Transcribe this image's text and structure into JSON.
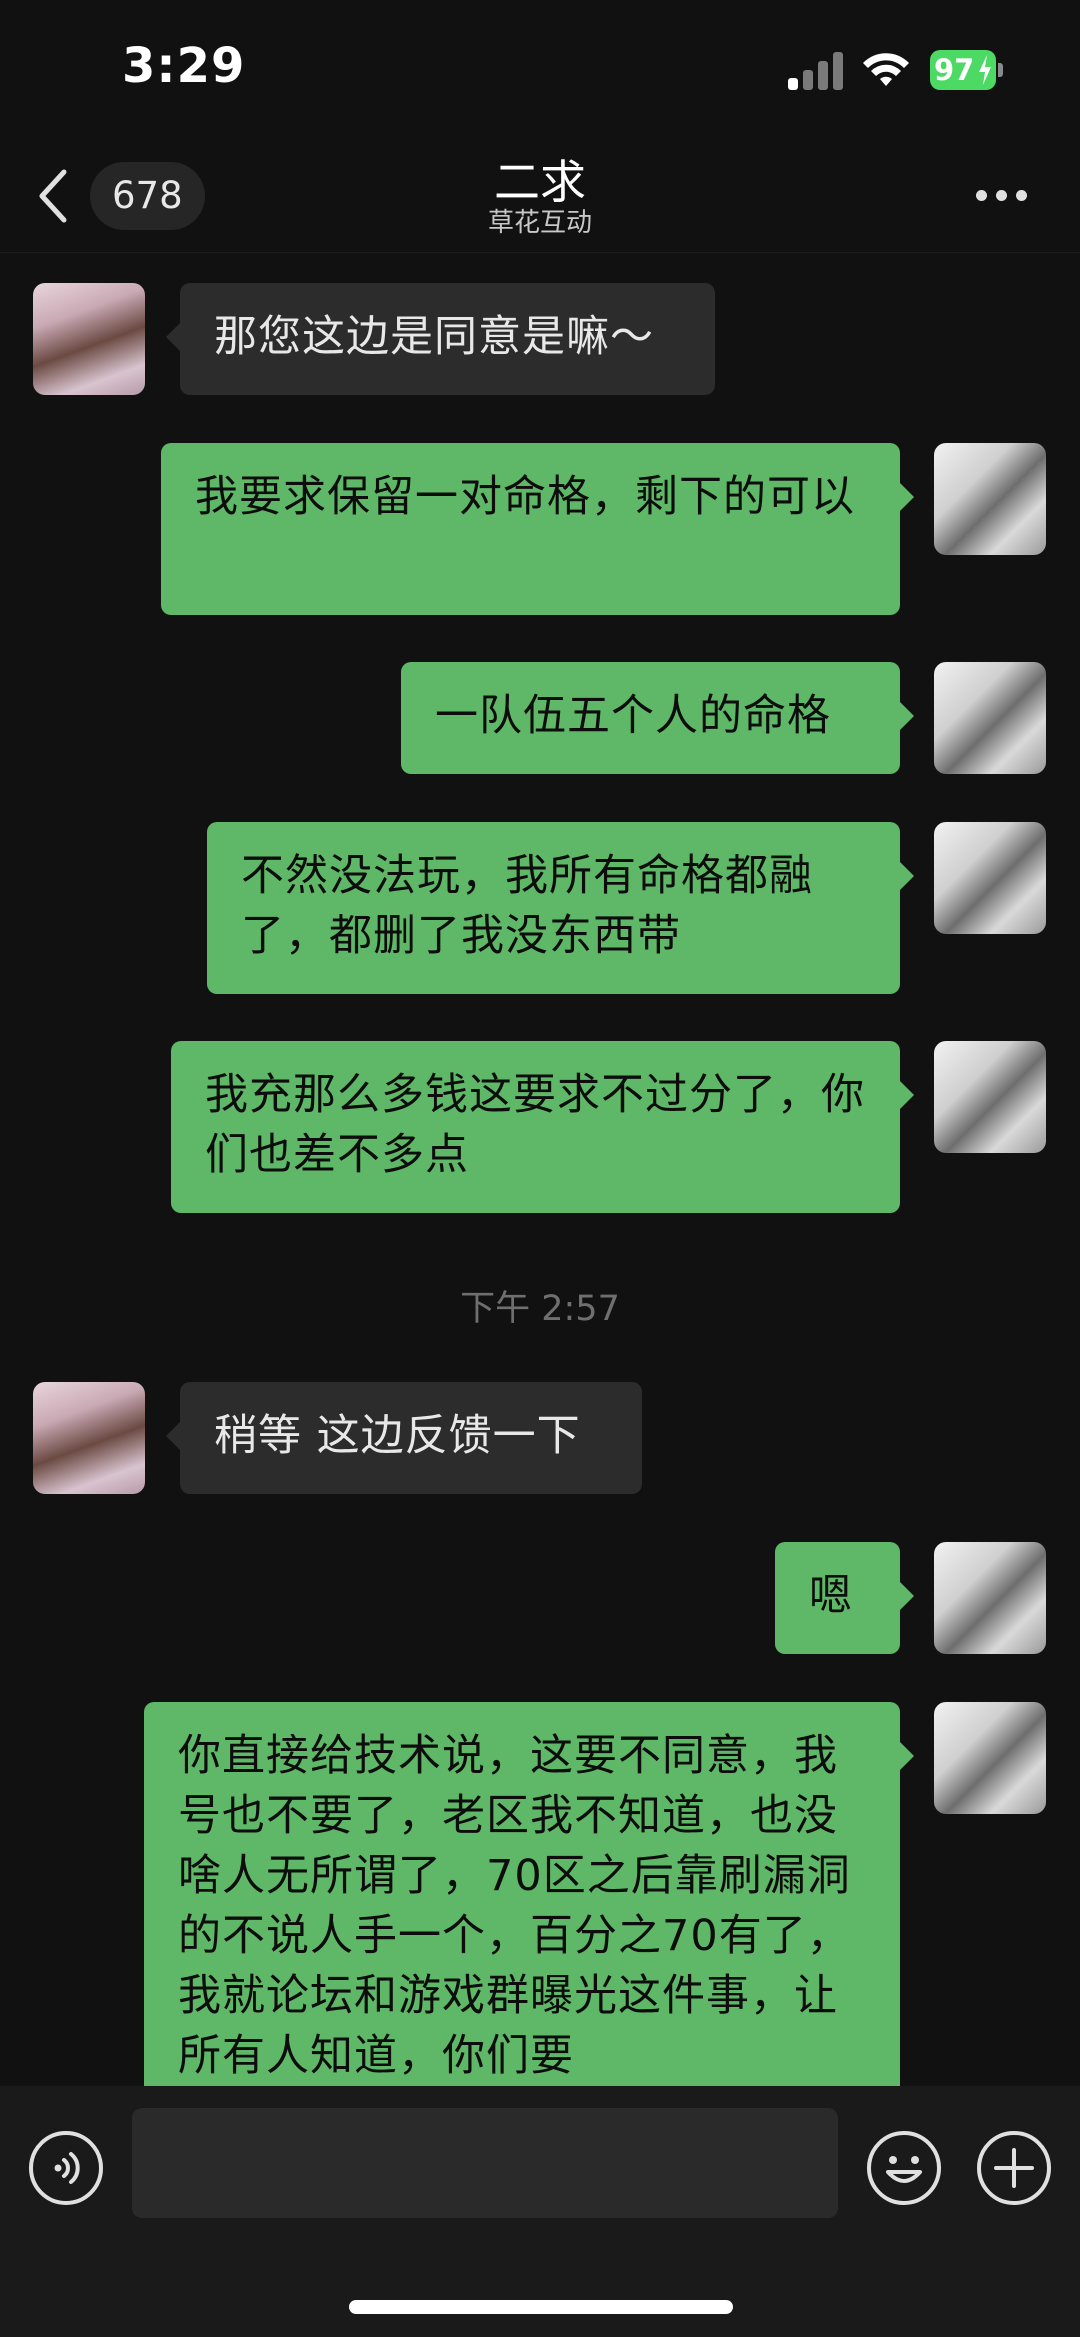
{
  "status_bar": {
    "time": "3:29",
    "battery_percent": "97"
  },
  "header": {
    "back_icon": "chevron-left-icon",
    "unread_count": "678",
    "title": "二求",
    "subtitle": "草花互动",
    "more_icon": "more-dots-icon"
  },
  "messages": [
    {
      "side": "in",
      "text": "那您这边是同意是嘛～"
    },
    {
      "side": "out",
      "text": "我要求保留一对命格，剩下的可以"
    },
    {
      "side": "out",
      "text": "一队伍五个人的命格"
    },
    {
      "side": "out",
      "text": "不然没法玩，我所有命格都融了，都删了我没东西带"
    },
    {
      "side": "out",
      "text": "我充那么多钱这要求不过分了，你们也差不多点"
    },
    {
      "side": "in",
      "text": "稍等 这边反馈一下"
    },
    {
      "side": "out",
      "text": "嗯"
    },
    {
      "side": "out",
      "text": "你直接给技术说，这要不同意，我号也不要了，老区我不知道，也没啥人无所谓了，70区之后靠刷漏洞的不说人手一个，百分之70有了，我就论坛和游戏群曝光这件事，让所有人知道，你们要"
    }
  ],
  "time_divider": "下午 2:57",
  "input_bar": {
    "voice_icon": "voice-icon",
    "emoji_icon": "emoji-icon",
    "plus_icon": "plus-icon",
    "input_value": ""
  },
  "colors": {
    "background": "#111111",
    "outgoing_bubble": "#5fb867",
    "incoming_bubble": "#2c2c2c",
    "battery": "#4cd964"
  }
}
